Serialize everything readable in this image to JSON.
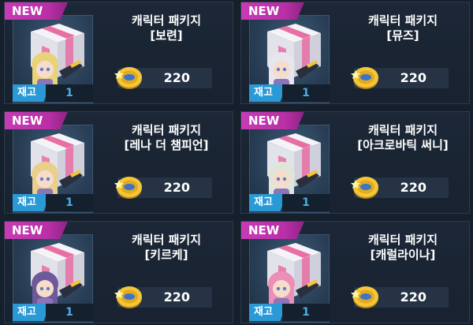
{
  "badge_new": "NEW",
  "stock_label": "재고",
  "currency_icon": "gold-coin-icon",
  "colors": {
    "new_badge": "#c73bb5",
    "stock_label": "#2a9ad6",
    "stock_value": "#49aee8",
    "card_bg": "#1c2737"
  },
  "packages": [
    {
      "title": "캐릭터 패키지",
      "subtitle": "[보련]",
      "stock": "1",
      "price": "220",
      "hair": "#e8d37a"
    },
    {
      "title": "캐릭터 패키지",
      "subtitle": "[뮤즈]",
      "stock": "1",
      "price": "220",
      "hair": "#e6e6ec"
    },
    {
      "title": "캐릭터 패키지",
      "subtitle": "[레나 더 챔피언]",
      "stock": "1",
      "price": "220",
      "hair": "#e9cf8c"
    },
    {
      "title": "캐릭터 패키지",
      "subtitle": "[아크로바틱 써니]",
      "stock": "1",
      "price": "220",
      "hair": "#dfe6d9"
    },
    {
      "title": "캐릭터 패키지",
      "subtitle": "[키르케]",
      "stock": "1",
      "price": "220",
      "hair": "#6e5a9a"
    },
    {
      "title": "캐릭터 패키지",
      "subtitle": "[캐럴라이나]",
      "stock": "1",
      "price": "220",
      "hair": "#ec8fb7"
    }
  ]
}
